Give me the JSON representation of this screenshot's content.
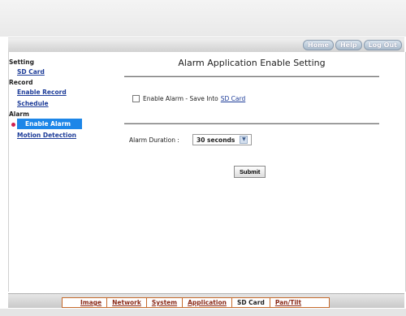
{
  "header": {
    "buttons": [
      "Home",
      "Help",
      "Log Out"
    ]
  },
  "sidebar": {
    "setting": {
      "label": "Setting",
      "items": [
        "SD Card"
      ]
    },
    "record": {
      "label": "Record",
      "items": [
        "Enable Record",
        "Schedule"
      ]
    },
    "alarm": {
      "label": "Alarm",
      "active_item": "Enable Alarm",
      "items": [
        "Motion Detection"
      ]
    }
  },
  "main": {
    "title": "Alarm Application Enable Setting",
    "checkbox_label": "Enable Alarm - Save Into",
    "checkbox_link": "SD Card",
    "checkbox_checked": false,
    "duration_label": "Alarm Duration :",
    "duration_value": "30 seconds",
    "submit_label": "Submit"
  },
  "tabs": {
    "items": [
      "Image",
      "Network",
      "System",
      "Application",
      "SD Card",
      "Pan/Tilt"
    ],
    "current": "SD Card"
  },
  "colors": {
    "active_bg": "#1d86e8",
    "link": "#1e3d99",
    "tab_border": "#c56a2c",
    "tab_text": "#8a2a18",
    "bullet": "#d02050"
  }
}
